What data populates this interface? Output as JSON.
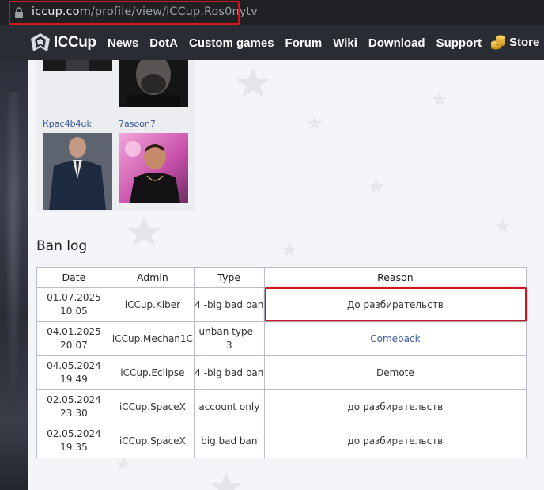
{
  "browser": {
    "url_host": "iccup.com",
    "url_path": "/profile/view/iCCup.Ros0nytv"
  },
  "nav": {
    "brand": "ICCup",
    "items": [
      "News",
      "DotA",
      "Custom games",
      "Forum",
      "Wiki",
      "Download",
      "Support"
    ],
    "store": "Store"
  },
  "friends": [
    {
      "name": ""
    },
    {
      "name": ""
    },
    {
      "name": "Крас4b4uk"
    },
    {
      "name": "7asoon7"
    }
  ],
  "ban_log": {
    "title": "Ban log",
    "headers": [
      "Date",
      "Admin",
      "Type",
      "Reason"
    ],
    "rows": [
      {
        "date": "01.07.2025",
        "time": "10:05",
        "admin": "iCCup.Kiber",
        "type": "4 -big bad ban",
        "reason": "До разбирательств",
        "reason_is_link": false
      },
      {
        "date": "04.01.2025",
        "time": "20:07",
        "admin": "iCCup.Mechan1C",
        "type": "unban type - 3",
        "reason": "Comeback",
        "reason_is_link": true
      },
      {
        "date": "04.05.2024",
        "time": "19:49",
        "admin": "iCCup.Eclipse",
        "type": "4 -big bad ban",
        "reason": "Demote",
        "reason_is_link": false
      },
      {
        "date": "02.05.2024",
        "time": "23:30",
        "admin": "iCCup.SpaceX",
        "type": "account only",
        "reason": "до разбирательств",
        "reason_is_link": false
      },
      {
        "date": "02.05.2024",
        "time": "19:35",
        "admin": "iCCup.SpaceX",
        "type": "big bad ban",
        "reason": "до разбирательств",
        "reason_is_link": false
      }
    ]
  },
  "colors": {
    "highlight": "#d3141c",
    "link": "#3a5b9a",
    "nav_bg": "#2a2c33"
  }
}
